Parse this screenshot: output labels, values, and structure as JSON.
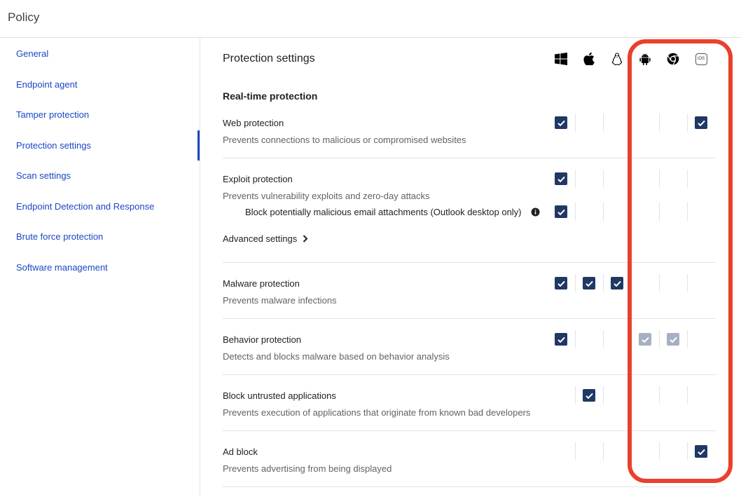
{
  "header": {
    "title": "Policy"
  },
  "sidebar": {
    "items": [
      {
        "label": "General"
      },
      {
        "label": "Endpoint agent"
      },
      {
        "label": "Tamper protection"
      },
      {
        "label": "Protection settings",
        "active": true
      },
      {
        "label": "Scan settings"
      },
      {
        "label": "Endpoint Detection and Response"
      },
      {
        "label": "Brute force protection"
      },
      {
        "label": "Software management"
      }
    ]
  },
  "main": {
    "title": "Protection settings",
    "section": "Real-time protection",
    "platforms": [
      "windows-icon",
      "apple-icon",
      "linux-icon",
      "android-icon",
      "chrome-icon",
      "ios-icon"
    ],
    "platform_ios_label": "iOS",
    "rows": [
      {
        "title": "Web protection",
        "desc": "Prevents connections to malicious or compromised websites",
        "checks": [
          "on",
          "",
          "",
          "",
          "",
          "on"
        ]
      },
      {
        "title": "Exploit protection",
        "desc": "Prevents vulnerability exploits and zero-day attacks",
        "checks": [
          "on",
          "",
          "",
          "",
          "",
          ""
        ],
        "sub": {
          "title": "Block potentially malicious email attachments (Outlook desktop only)",
          "checks": [
            "on",
            "",
            "",
            "",
            "",
            ""
          ]
        }
      },
      {
        "title": "Malware protection",
        "desc": "Prevents malware infections",
        "checks": [
          "on",
          "on",
          "on",
          "",
          "",
          ""
        ]
      },
      {
        "title": "Behavior protection",
        "desc": "Detects and blocks malware based on behavior analysis",
        "checks": [
          "on",
          "",
          "",
          "dim",
          "dim",
          ""
        ]
      },
      {
        "title": "Block untrusted applications",
        "desc": "Prevents execution of applications that originate from known bad developers",
        "checks": [
          "",
          "on",
          "",
          "",
          "",
          ""
        ]
      },
      {
        "title": "Ad block",
        "desc": "Prevents advertising from being displayed",
        "checks": [
          "",
          "",
          "",
          "",
          "",
          "on"
        ]
      }
    ],
    "advanced_label": "Advanced settings"
  },
  "colors": {
    "accent": "#1a47c4",
    "checkbox": "#1f3864",
    "checkbox_disabled": "#a7b0c2",
    "highlight": "#e8412c"
  }
}
